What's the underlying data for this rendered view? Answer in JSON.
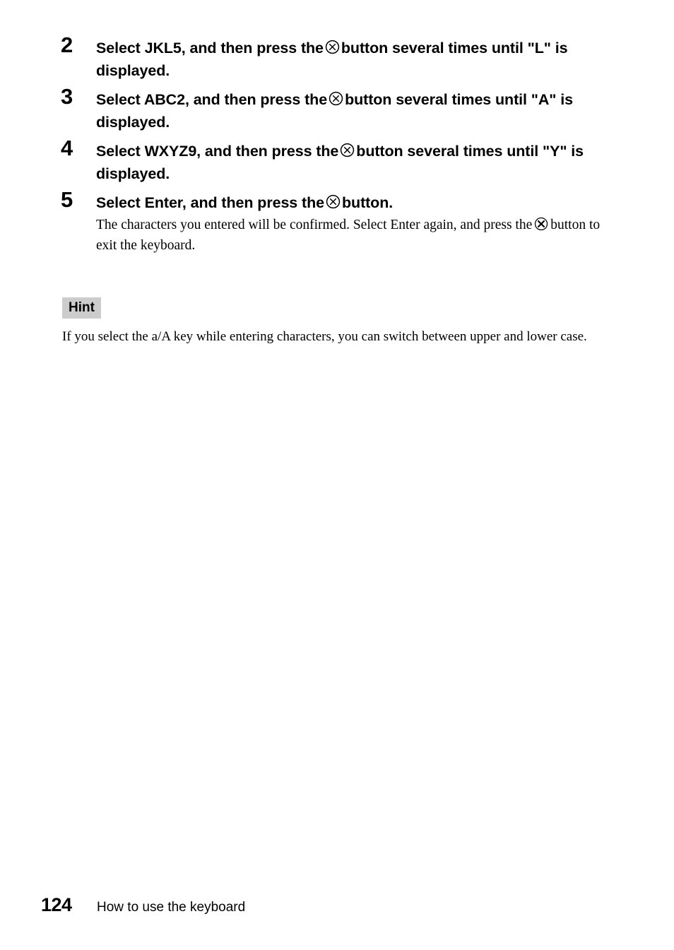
{
  "document": {
    "page_number": "124",
    "footer_title": "How to use the keyboard"
  },
  "icons": {
    "cross_button": "cross-button-icon"
  },
  "steps": [
    {
      "number": "2",
      "title_before_icon": "Select JKL5, and then press the",
      "title_after_icon": "button several times until \"L\" is displayed.",
      "description": ""
    },
    {
      "number": "3",
      "title_before_icon": "Select ABC2, and then press the",
      "title_after_icon": "button several times until \"A\" is displayed.",
      "description": ""
    },
    {
      "number": "4",
      "title_before_icon": "Select WXYZ9, and then press the",
      "title_after_icon": "button several times until \"Y\" is displayed.",
      "description": ""
    },
    {
      "number": "5",
      "title_before_icon": "Select Enter, and then press the",
      "title_after_icon": "button.",
      "desc_before_icon": "The characters you entered will be confirmed. Select Enter again, and press the",
      "desc_after_icon": "button to exit the keyboard."
    }
  ],
  "hint": {
    "label": "Hint",
    "text": "If you select the a/A key while entering characters, you can switch between upper and lower case."
  }
}
